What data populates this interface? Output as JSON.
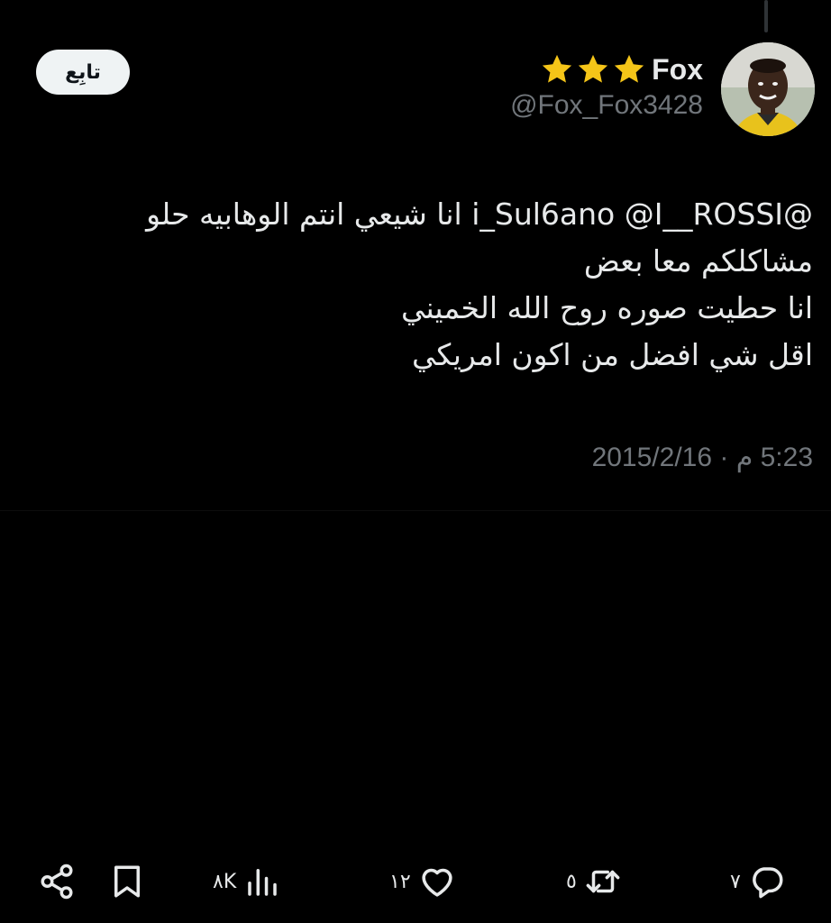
{
  "follow_button": {
    "label": "تابِع"
  },
  "user": {
    "display_name": "Fox",
    "handle": "@Fox_Fox3428",
    "badges": [
      "star-icon",
      "star-icon",
      "star-icon"
    ],
    "star_color": "#f5c518"
  },
  "tweet": {
    "lines": [
      "@i_Sul6ano @I__ROSSI انا شيعي انتم الوهابيه حلو",
      "مشاكلكم معا بعض",
      "انا حطيت صوره روح الله الخميني",
      "اقل شي افضل من اكون امريكي"
    ],
    "timestamp": "5:23 م · 2015/2/16"
  },
  "actions": {
    "reply": {
      "icon": "reply-icon",
      "count": "٧"
    },
    "retweet": {
      "icon": "retweet-icon",
      "count": "٥"
    },
    "like": {
      "icon": "heart-icon",
      "count": "١٢"
    },
    "views": {
      "icon": "views-icon",
      "count": "٨K"
    },
    "bookmark": {
      "icon": "bookmark-icon"
    },
    "share": {
      "icon": "share-icon"
    }
  }
}
